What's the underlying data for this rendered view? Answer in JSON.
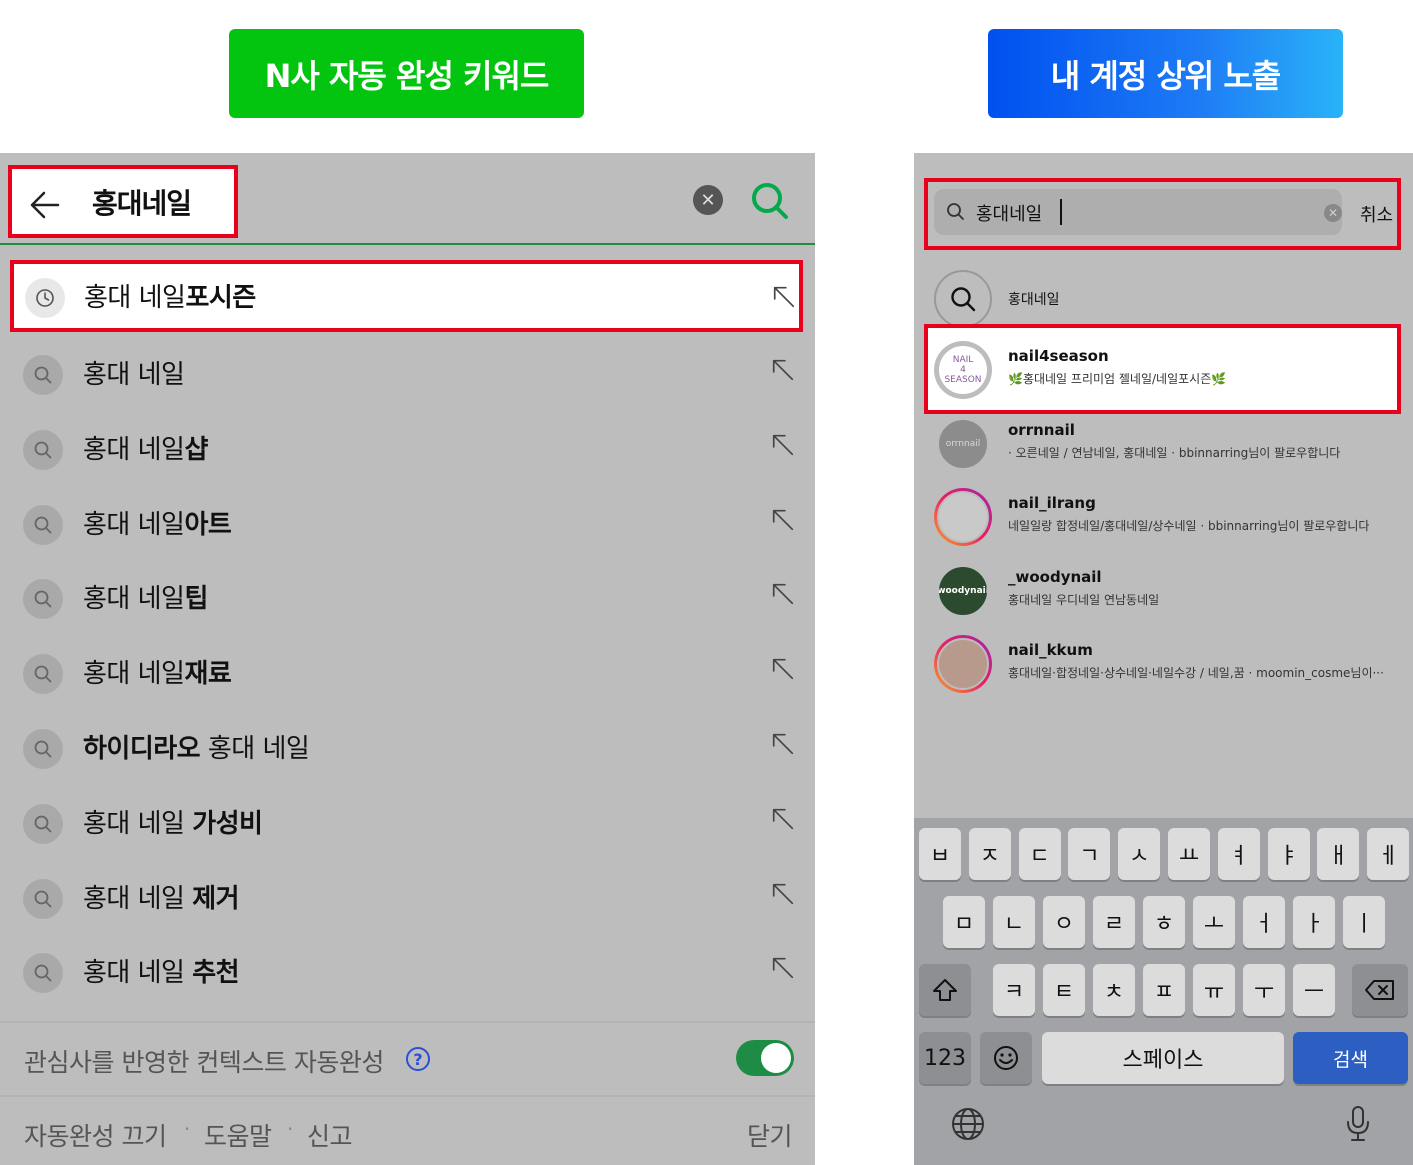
{
  "banners": {
    "left": "N사 자동 완성 키워드",
    "right": "내 계정 상위 노출"
  },
  "colors": {
    "naver_green": "#03c40f",
    "highlight_red": "#e8001c",
    "toggle_green": "#1e8c45"
  },
  "naver": {
    "query": "홍대네일",
    "suggestions": [
      {
        "plain": "홍대 네일",
        "bold": "포시즌",
        "bold_first": false,
        "icon": "clock-icon"
      },
      {
        "plain": "홍대 네일",
        "bold": "",
        "bold_first": false,
        "icon": "search-icon"
      },
      {
        "plain": "홍대 네일",
        "bold": "샵",
        "bold_first": false,
        "icon": "search-icon"
      },
      {
        "plain": "홍대 네일",
        "bold": "아트",
        "bold_first": false,
        "icon": "search-icon"
      },
      {
        "plain": "홍대 네일",
        "bold": "팁",
        "bold_first": false,
        "icon": "search-icon"
      },
      {
        "plain": "홍대 네일",
        "bold": "재료",
        "bold_first": false,
        "icon": "search-icon"
      },
      {
        "plain": " 홍대 네일",
        "bold": "하이디라오",
        "bold_first": true,
        "icon": "search-icon"
      },
      {
        "plain": "홍대 네일 ",
        "bold": "가성비",
        "bold_first": false,
        "icon": "search-icon"
      },
      {
        "plain": "홍대 네일 ",
        "bold": "제거",
        "bold_first": false,
        "icon": "search-icon"
      },
      {
        "plain": "홍대 네일 ",
        "bold": "추천",
        "bold_first": false,
        "icon": "search-icon"
      }
    ],
    "context_label": "관심사를 반영한 컨텍스트 자동완성",
    "help": "?",
    "toggle_on": true,
    "footer": {
      "off": "자동완성 끄기",
      "help": "도움말",
      "report": "신고",
      "close": "닫기",
      "sep": "·"
    }
  },
  "instagram": {
    "query": "홍대네일",
    "cancel": "취소",
    "query_suggestion": "홍대네일",
    "accounts": [
      {
        "username": "nail4season",
        "subtitle": "🌿홍대네일 프리미엄 젤네일/네일포시즌🌿",
        "avatar_text": [
          "NAIL",
          "4",
          "SEASON"
        ]
      },
      {
        "username": "orrnnail",
        "subtitle": "· 오른네일 / 연남네일, 홍대네일 · bbinnarring님이 팔로우합니다",
        "avatar_text": [
          "orrnnail"
        ]
      },
      {
        "username": "nail_ilrang",
        "subtitle": "네일일랑 합정네일/홍대네일/상수네일 · bbinnarring님이 팔로우합니다",
        "avatar_text": []
      },
      {
        "username": "_woodynail",
        "subtitle": "홍대네일 우디네일 연남동네일",
        "avatar_text": [
          "woodynail"
        ]
      },
      {
        "username": "nail_kkum",
        "subtitle": "홍대네일·합정네일·상수네일·네일수강 / 네일,꿈 · moomin_cosme님이···",
        "avatar_text": []
      }
    ],
    "keyboard": {
      "row1": [
        "ㅂ",
        "ㅈ",
        "ㄷ",
        "ㄱ",
        "ㅅ",
        "ㅛ",
        "ㅕ",
        "ㅑ",
        "ㅐ",
        "ㅔ"
      ],
      "row2": [
        "ㅁ",
        "ㄴ",
        "ㅇ",
        "ㄹ",
        "ㅎ",
        "ㅗ",
        "ㅓ",
        "ㅏ",
        "ㅣ"
      ],
      "row3": [
        "ㅋ",
        "ㅌ",
        "ㅊ",
        "ㅍ",
        "ㅠ",
        "ㅜ",
        "ㅡ"
      ],
      "numbers": "123",
      "space": "스페이스",
      "search": "검색"
    }
  }
}
